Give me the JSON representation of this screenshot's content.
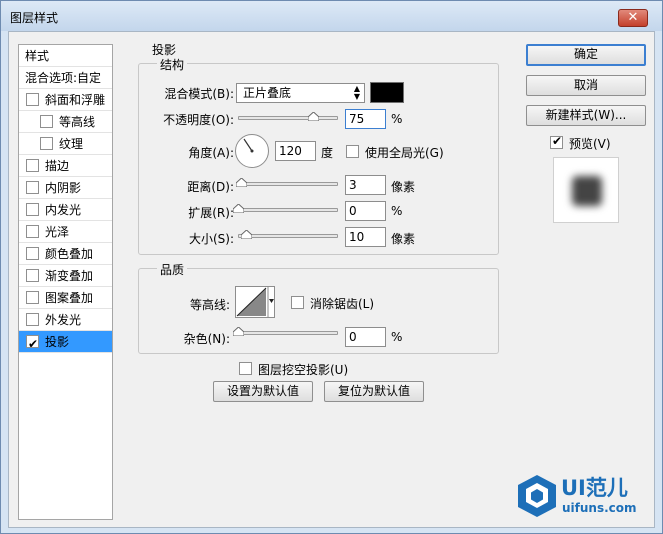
{
  "window": {
    "title": "图层样式",
    "close": "✕"
  },
  "left_list": {
    "header": "样式",
    "blend": "混合选项:自定",
    "items": [
      {
        "label": "斜面和浮雕",
        "checked": false
      },
      {
        "label": "等高线",
        "checked": false
      },
      {
        "label": "纹理",
        "checked": false
      },
      {
        "label": "描边",
        "checked": false
      },
      {
        "label": "内阴影",
        "checked": false
      },
      {
        "label": "内发光",
        "checked": false
      },
      {
        "label": "光泽",
        "checked": false
      },
      {
        "label": "颜色叠加",
        "checked": false
      },
      {
        "label": "渐变叠加",
        "checked": false
      },
      {
        "label": "图案叠加",
        "checked": false
      },
      {
        "label": "外发光",
        "checked": false
      },
      {
        "label": "投影",
        "checked": true
      }
    ]
  },
  "main": {
    "title": "投影",
    "structure": {
      "title": "结构",
      "blend_mode_label": "混合模式(B):",
      "blend_mode_value": "正片叠底",
      "shadow_color": "#000000",
      "opacity_label": "不透明度(O):",
      "opacity_value": "75",
      "opacity_unit": "%",
      "opacity_level": 0.75,
      "angle_label": "角度(A):",
      "angle_value": "120",
      "angle_unit": "度",
      "global_light_label": "使用全局光(G)",
      "global_light_checked": false,
      "distance_label": "距离(D):",
      "distance_value": "3",
      "distance_unit": "像素",
      "spread_label": "扩展(R):",
      "spread_value": "0",
      "spread_unit": "%",
      "size_label": "大小(S):",
      "size_value": "10",
      "size_unit": "像素"
    },
    "quality": {
      "title": "品质",
      "contour_label": "等高线:",
      "antialias_label": "消除锯齿(L)",
      "antialias_checked": false,
      "noise_label": "杂色(N):",
      "noise_value": "0",
      "noise_unit": "%"
    },
    "knockout_label": "图层挖空投影(U)",
    "make_default": "设置为默认值",
    "reset_default": "复位为默认值"
  },
  "right": {
    "ok": "确定",
    "cancel": "取消",
    "new_style": "新建样式(W)...",
    "preview_label": "预览(V)",
    "preview_checked": true
  },
  "watermark": {
    "brand": "UI范儿",
    "url": "uifuns.com"
  },
  "icons": {
    "close": "close-icon",
    "check": "check-icon",
    "dial": "angle-dial-icon",
    "contour": "contour-curve-icon",
    "logo": "uifuns-cube-logo"
  }
}
